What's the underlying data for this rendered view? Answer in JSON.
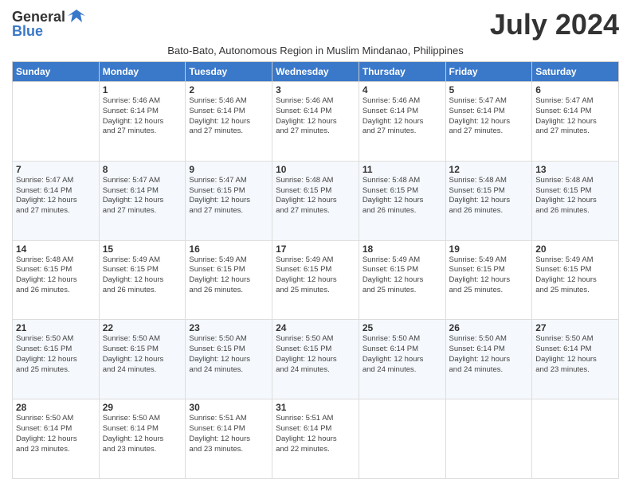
{
  "header": {
    "logo_general": "General",
    "logo_blue": "Blue",
    "month_title": "July 2024",
    "subtitle": "Bato-Bato, Autonomous Region in Muslim Mindanao, Philippines"
  },
  "days_of_week": [
    "Sunday",
    "Monday",
    "Tuesday",
    "Wednesday",
    "Thursday",
    "Friday",
    "Saturday"
  ],
  "weeks": [
    [
      {
        "day": "",
        "sunrise": "",
        "sunset": "",
        "daylight": ""
      },
      {
        "day": "1",
        "sunrise": "Sunrise: 5:46 AM",
        "sunset": "Sunset: 6:14 PM",
        "daylight": "Daylight: 12 hours and 27 minutes."
      },
      {
        "day": "2",
        "sunrise": "Sunrise: 5:46 AM",
        "sunset": "Sunset: 6:14 PM",
        "daylight": "Daylight: 12 hours and 27 minutes."
      },
      {
        "day": "3",
        "sunrise": "Sunrise: 5:46 AM",
        "sunset": "Sunset: 6:14 PM",
        "daylight": "Daylight: 12 hours and 27 minutes."
      },
      {
        "day": "4",
        "sunrise": "Sunrise: 5:46 AM",
        "sunset": "Sunset: 6:14 PM",
        "daylight": "Daylight: 12 hours and 27 minutes."
      },
      {
        "day": "5",
        "sunrise": "Sunrise: 5:47 AM",
        "sunset": "Sunset: 6:14 PM",
        "daylight": "Daylight: 12 hours and 27 minutes."
      },
      {
        "day": "6",
        "sunrise": "Sunrise: 5:47 AM",
        "sunset": "Sunset: 6:14 PM",
        "daylight": "Daylight: 12 hours and 27 minutes."
      }
    ],
    [
      {
        "day": "7",
        "sunrise": "Sunrise: 5:47 AM",
        "sunset": "Sunset: 6:14 PM",
        "daylight": "Daylight: 12 hours and 27 minutes."
      },
      {
        "day": "8",
        "sunrise": "Sunrise: 5:47 AM",
        "sunset": "Sunset: 6:14 PM",
        "daylight": "Daylight: 12 hours and 27 minutes."
      },
      {
        "day": "9",
        "sunrise": "Sunrise: 5:47 AM",
        "sunset": "Sunset: 6:15 PM",
        "daylight": "Daylight: 12 hours and 27 minutes."
      },
      {
        "day": "10",
        "sunrise": "Sunrise: 5:48 AM",
        "sunset": "Sunset: 6:15 PM",
        "daylight": "Daylight: 12 hours and 27 minutes."
      },
      {
        "day": "11",
        "sunrise": "Sunrise: 5:48 AM",
        "sunset": "Sunset: 6:15 PM",
        "daylight": "Daylight: 12 hours and 26 minutes."
      },
      {
        "day": "12",
        "sunrise": "Sunrise: 5:48 AM",
        "sunset": "Sunset: 6:15 PM",
        "daylight": "Daylight: 12 hours and 26 minutes."
      },
      {
        "day": "13",
        "sunrise": "Sunrise: 5:48 AM",
        "sunset": "Sunset: 6:15 PM",
        "daylight": "Daylight: 12 hours and 26 minutes."
      }
    ],
    [
      {
        "day": "14",
        "sunrise": "Sunrise: 5:48 AM",
        "sunset": "Sunset: 6:15 PM",
        "daylight": "Daylight: 12 hours and 26 minutes."
      },
      {
        "day": "15",
        "sunrise": "Sunrise: 5:49 AM",
        "sunset": "Sunset: 6:15 PM",
        "daylight": "Daylight: 12 hours and 26 minutes."
      },
      {
        "day": "16",
        "sunrise": "Sunrise: 5:49 AM",
        "sunset": "Sunset: 6:15 PM",
        "daylight": "Daylight: 12 hours and 26 minutes."
      },
      {
        "day": "17",
        "sunrise": "Sunrise: 5:49 AM",
        "sunset": "Sunset: 6:15 PM",
        "daylight": "Daylight: 12 hours and 25 minutes."
      },
      {
        "day": "18",
        "sunrise": "Sunrise: 5:49 AM",
        "sunset": "Sunset: 6:15 PM",
        "daylight": "Daylight: 12 hours and 25 minutes."
      },
      {
        "day": "19",
        "sunrise": "Sunrise: 5:49 AM",
        "sunset": "Sunset: 6:15 PM",
        "daylight": "Daylight: 12 hours and 25 minutes."
      },
      {
        "day": "20",
        "sunrise": "Sunrise: 5:49 AM",
        "sunset": "Sunset: 6:15 PM",
        "daylight": "Daylight: 12 hours and 25 minutes."
      }
    ],
    [
      {
        "day": "21",
        "sunrise": "Sunrise: 5:50 AM",
        "sunset": "Sunset: 6:15 PM",
        "daylight": "Daylight: 12 hours and 25 minutes."
      },
      {
        "day": "22",
        "sunrise": "Sunrise: 5:50 AM",
        "sunset": "Sunset: 6:15 PM",
        "daylight": "Daylight: 12 hours and 24 minutes."
      },
      {
        "day": "23",
        "sunrise": "Sunrise: 5:50 AM",
        "sunset": "Sunset: 6:15 PM",
        "daylight": "Daylight: 12 hours and 24 minutes."
      },
      {
        "day": "24",
        "sunrise": "Sunrise: 5:50 AM",
        "sunset": "Sunset: 6:15 PM",
        "daylight": "Daylight: 12 hours and 24 minutes."
      },
      {
        "day": "25",
        "sunrise": "Sunrise: 5:50 AM",
        "sunset": "Sunset: 6:14 PM",
        "daylight": "Daylight: 12 hours and 24 minutes."
      },
      {
        "day": "26",
        "sunrise": "Sunrise: 5:50 AM",
        "sunset": "Sunset: 6:14 PM",
        "daylight": "Daylight: 12 hours and 24 minutes."
      },
      {
        "day": "27",
        "sunrise": "Sunrise: 5:50 AM",
        "sunset": "Sunset: 6:14 PM",
        "daylight": "Daylight: 12 hours and 23 minutes."
      }
    ],
    [
      {
        "day": "28",
        "sunrise": "Sunrise: 5:50 AM",
        "sunset": "Sunset: 6:14 PM",
        "daylight": "Daylight: 12 hours and 23 minutes."
      },
      {
        "day": "29",
        "sunrise": "Sunrise: 5:50 AM",
        "sunset": "Sunset: 6:14 PM",
        "daylight": "Daylight: 12 hours and 23 minutes."
      },
      {
        "day": "30",
        "sunrise": "Sunrise: 5:51 AM",
        "sunset": "Sunset: 6:14 PM",
        "daylight": "Daylight: 12 hours and 23 minutes."
      },
      {
        "day": "31",
        "sunrise": "Sunrise: 5:51 AM",
        "sunset": "Sunset: 6:14 PM",
        "daylight": "Daylight: 12 hours and 22 minutes."
      },
      {
        "day": "",
        "sunrise": "",
        "sunset": "",
        "daylight": ""
      },
      {
        "day": "",
        "sunrise": "",
        "sunset": "",
        "daylight": ""
      },
      {
        "day": "",
        "sunrise": "",
        "sunset": "",
        "daylight": ""
      }
    ]
  ]
}
